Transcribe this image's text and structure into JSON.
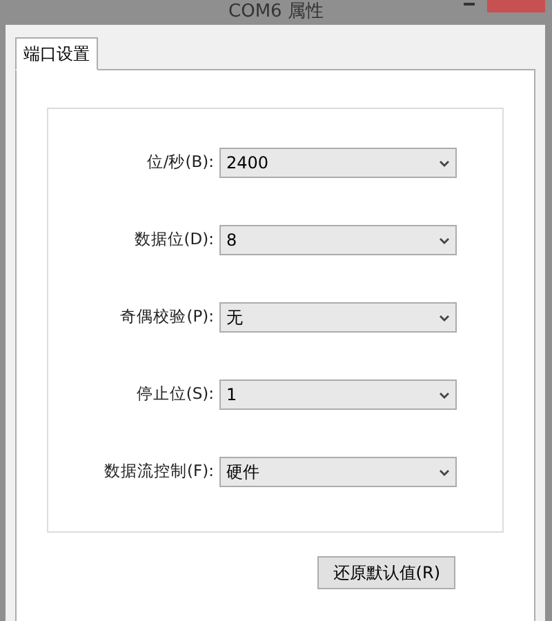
{
  "window": {
    "title": "COM6 属性"
  },
  "tabs": [
    {
      "label": "端口设置",
      "selected": true
    }
  ],
  "fields": [
    {
      "label": "位/秒(B):",
      "value": "2400"
    },
    {
      "label": "数据位(D):",
      "value": "8"
    },
    {
      "label": "奇偶校验(P):",
      "value": "无"
    },
    {
      "label": "停止位(S):",
      "value": "1"
    },
    {
      "label": "数据流控制(F):",
      "value": "硬件"
    }
  ],
  "buttons": [
    "还原默认值(R)"
  ]
}
